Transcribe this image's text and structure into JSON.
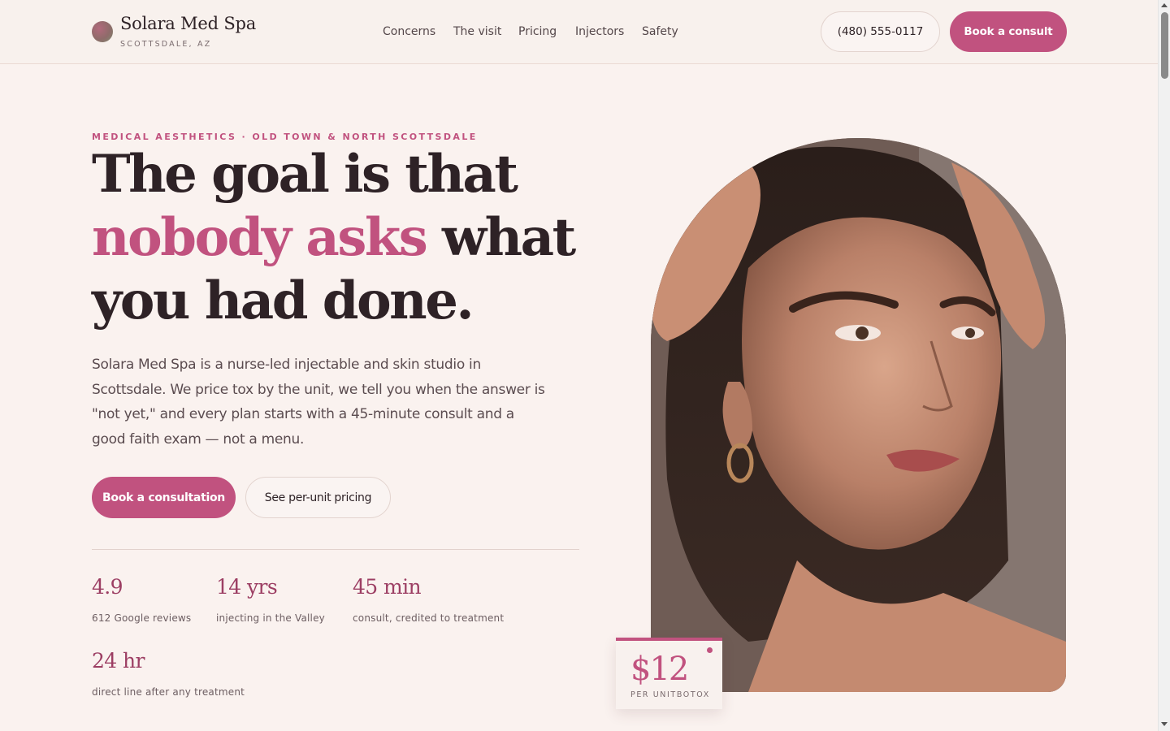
{
  "header": {
    "brand_name": "Solara Med Spa",
    "brand_location": "SCOTTSDALE, AZ",
    "nav": [
      {
        "label": "Concerns"
      },
      {
        "label": "The visit"
      },
      {
        "label": "Pricing"
      },
      {
        "label": "Injectors"
      },
      {
        "label": "Safety"
      }
    ],
    "phone_label": "(480) 555-0117",
    "book_label": "Book a consult"
  },
  "hero": {
    "eyebrow": "MEDICAL AESTHETICS · OLD TOWN & NORTH SCOTTSDALE",
    "headline_part1": "The goal is that ",
    "headline_accent": "nobody asks",
    "headline_part2": " what you had done.",
    "lede": "Solara Med Spa is a nurse-led injectable and skin studio in Scottsdale. We price tox by the unit, we tell you when the answer is \"not yet,\" and every plan starts with a 45-minute consult and a good faith exam — not a menu.",
    "cta_primary": "Book a consultation",
    "cta_secondary": "See per-unit pricing"
  },
  "stats": [
    {
      "value": "4.9",
      "label": "612 Google reviews"
    },
    {
      "value": "14 yrs",
      "label": "injecting in the Valley"
    },
    {
      "value": "45 min",
      "label": "consult, credited to treatment"
    },
    {
      "value": "24 hr",
      "label": "direct line after any treatment"
    }
  ],
  "price_card": {
    "price": "$12",
    "unit": "PER UNITBOTOX"
  },
  "colors": {
    "accent": "#c1527f",
    "accent_dark": "#9c3e63",
    "background": "#faf2ef",
    "text": "#2e2226"
  }
}
